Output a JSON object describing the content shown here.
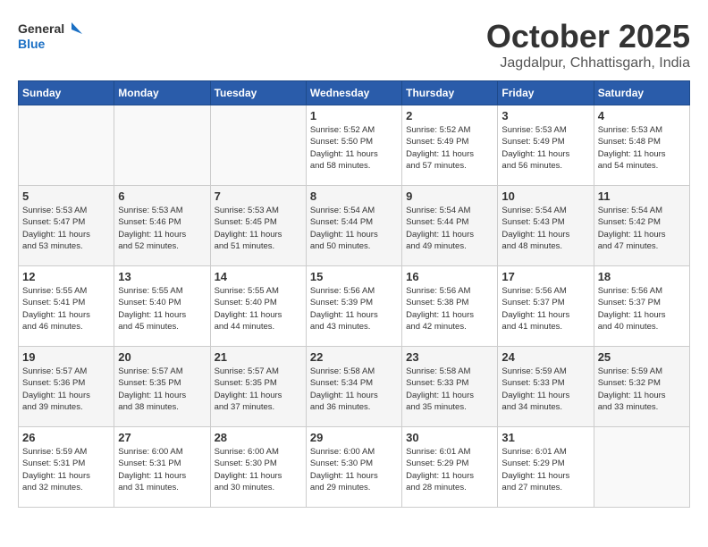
{
  "header": {
    "logo_general": "General",
    "logo_blue": "Blue",
    "month": "October 2025",
    "location": "Jagdalpur, Chhattisgarh, India"
  },
  "days_of_week": [
    "Sunday",
    "Monday",
    "Tuesday",
    "Wednesday",
    "Thursday",
    "Friday",
    "Saturday"
  ],
  "weeks": [
    [
      {
        "day": "",
        "info": ""
      },
      {
        "day": "",
        "info": ""
      },
      {
        "day": "",
        "info": ""
      },
      {
        "day": "1",
        "info": "Sunrise: 5:52 AM\nSunset: 5:50 PM\nDaylight: 11 hours\nand 58 minutes."
      },
      {
        "day": "2",
        "info": "Sunrise: 5:52 AM\nSunset: 5:49 PM\nDaylight: 11 hours\nand 57 minutes."
      },
      {
        "day": "3",
        "info": "Sunrise: 5:53 AM\nSunset: 5:49 PM\nDaylight: 11 hours\nand 56 minutes."
      },
      {
        "day": "4",
        "info": "Sunrise: 5:53 AM\nSunset: 5:48 PM\nDaylight: 11 hours\nand 54 minutes."
      }
    ],
    [
      {
        "day": "5",
        "info": "Sunrise: 5:53 AM\nSunset: 5:47 PM\nDaylight: 11 hours\nand 53 minutes."
      },
      {
        "day": "6",
        "info": "Sunrise: 5:53 AM\nSunset: 5:46 PM\nDaylight: 11 hours\nand 52 minutes."
      },
      {
        "day": "7",
        "info": "Sunrise: 5:53 AM\nSunset: 5:45 PM\nDaylight: 11 hours\nand 51 minutes."
      },
      {
        "day": "8",
        "info": "Sunrise: 5:54 AM\nSunset: 5:44 PM\nDaylight: 11 hours\nand 50 minutes."
      },
      {
        "day": "9",
        "info": "Sunrise: 5:54 AM\nSunset: 5:44 PM\nDaylight: 11 hours\nand 49 minutes."
      },
      {
        "day": "10",
        "info": "Sunrise: 5:54 AM\nSunset: 5:43 PM\nDaylight: 11 hours\nand 48 minutes."
      },
      {
        "day": "11",
        "info": "Sunrise: 5:54 AM\nSunset: 5:42 PM\nDaylight: 11 hours\nand 47 minutes."
      }
    ],
    [
      {
        "day": "12",
        "info": "Sunrise: 5:55 AM\nSunset: 5:41 PM\nDaylight: 11 hours\nand 46 minutes."
      },
      {
        "day": "13",
        "info": "Sunrise: 5:55 AM\nSunset: 5:40 PM\nDaylight: 11 hours\nand 45 minutes."
      },
      {
        "day": "14",
        "info": "Sunrise: 5:55 AM\nSunset: 5:40 PM\nDaylight: 11 hours\nand 44 minutes."
      },
      {
        "day": "15",
        "info": "Sunrise: 5:56 AM\nSunset: 5:39 PM\nDaylight: 11 hours\nand 43 minutes."
      },
      {
        "day": "16",
        "info": "Sunrise: 5:56 AM\nSunset: 5:38 PM\nDaylight: 11 hours\nand 42 minutes."
      },
      {
        "day": "17",
        "info": "Sunrise: 5:56 AM\nSunset: 5:37 PM\nDaylight: 11 hours\nand 41 minutes."
      },
      {
        "day": "18",
        "info": "Sunrise: 5:56 AM\nSunset: 5:37 PM\nDaylight: 11 hours\nand 40 minutes."
      }
    ],
    [
      {
        "day": "19",
        "info": "Sunrise: 5:57 AM\nSunset: 5:36 PM\nDaylight: 11 hours\nand 39 minutes."
      },
      {
        "day": "20",
        "info": "Sunrise: 5:57 AM\nSunset: 5:35 PM\nDaylight: 11 hours\nand 38 minutes."
      },
      {
        "day": "21",
        "info": "Sunrise: 5:57 AM\nSunset: 5:35 PM\nDaylight: 11 hours\nand 37 minutes."
      },
      {
        "day": "22",
        "info": "Sunrise: 5:58 AM\nSunset: 5:34 PM\nDaylight: 11 hours\nand 36 minutes."
      },
      {
        "day": "23",
        "info": "Sunrise: 5:58 AM\nSunset: 5:33 PM\nDaylight: 11 hours\nand 35 minutes."
      },
      {
        "day": "24",
        "info": "Sunrise: 5:59 AM\nSunset: 5:33 PM\nDaylight: 11 hours\nand 34 minutes."
      },
      {
        "day": "25",
        "info": "Sunrise: 5:59 AM\nSunset: 5:32 PM\nDaylight: 11 hours\nand 33 minutes."
      }
    ],
    [
      {
        "day": "26",
        "info": "Sunrise: 5:59 AM\nSunset: 5:31 PM\nDaylight: 11 hours\nand 32 minutes."
      },
      {
        "day": "27",
        "info": "Sunrise: 6:00 AM\nSunset: 5:31 PM\nDaylight: 11 hours\nand 31 minutes."
      },
      {
        "day": "28",
        "info": "Sunrise: 6:00 AM\nSunset: 5:30 PM\nDaylight: 11 hours\nand 30 minutes."
      },
      {
        "day": "29",
        "info": "Sunrise: 6:00 AM\nSunset: 5:30 PM\nDaylight: 11 hours\nand 29 minutes."
      },
      {
        "day": "30",
        "info": "Sunrise: 6:01 AM\nSunset: 5:29 PM\nDaylight: 11 hours\nand 28 minutes."
      },
      {
        "day": "31",
        "info": "Sunrise: 6:01 AM\nSunset: 5:29 PM\nDaylight: 11 hours\nand 27 minutes."
      },
      {
        "day": "",
        "info": ""
      }
    ]
  ]
}
